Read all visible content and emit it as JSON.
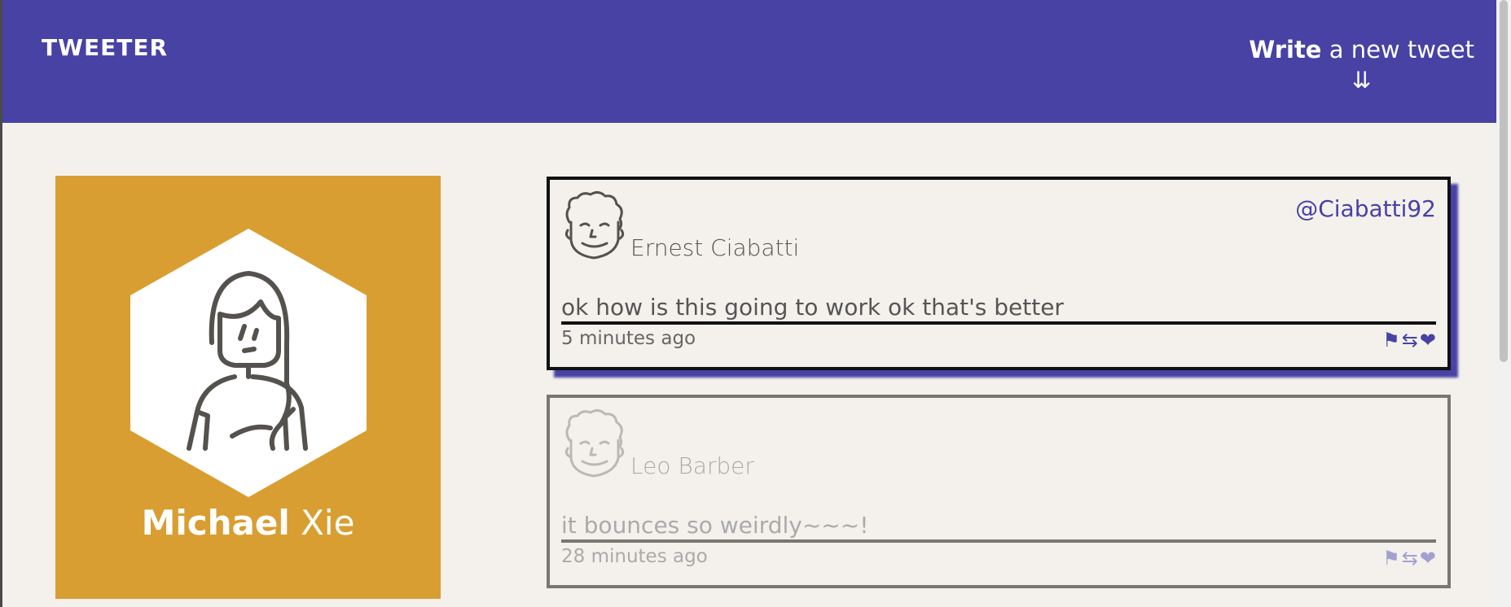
{
  "header": {
    "logo": "TWEETER",
    "compose_bold": "Write",
    "compose_rest": " a new tweet",
    "compose_arrow": "⇊"
  },
  "profile": {
    "first_name": "Michael",
    "last_name": "Xie",
    "background_color": "#d99e31"
  },
  "tweets": [
    {
      "name": "Ernest Ciabatti",
      "handle": "@Ciabatti92",
      "content": "ok how is this going to work ok that's better",
      "time": "5 minutes ago",
      "state": "hovered"
    },
    {
      "name": "Leo Barber",
      "handle": "",
      "content": "it bounces so weirdly~~~!",
      "time": "28 minutes ago",
      "state": "normal"
    }
  ],
  "icons": {
    "flag": "flag-icon",
    "retweet": "retweet-icon",
    "like": "heart-icon"
  },
  "colors": {
    "brand": "#4742a4",
    "background": "#f4f1ed"
  }
}
